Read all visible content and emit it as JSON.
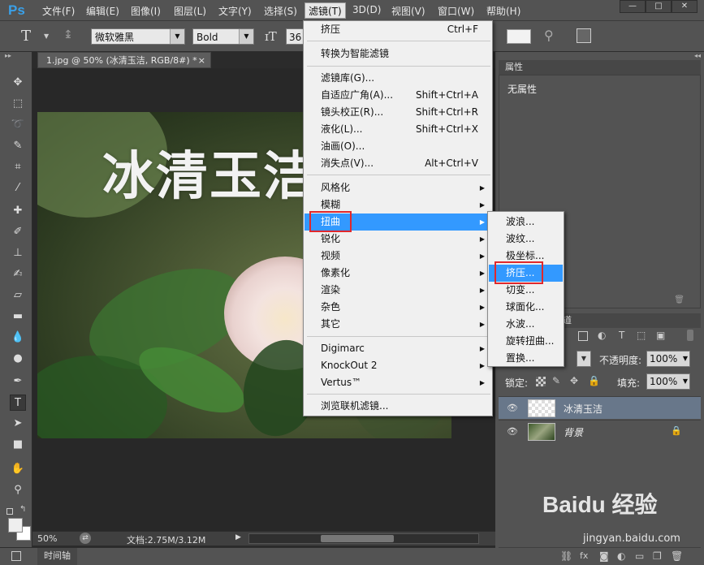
{
  "menubar": {
    "logo": "Ps",
    "items": [
      "文件(F)",
      "编辑(E)",
      "图像(I)",
      "图层(L)",
      "文字(Y)",
      "选择(S)",
      "滤镜(T)",
      "3D(D)",
      "视图(V)",
      "窗口(W)",
      "帮助(H)"
    ],
    "active_index": 6,
    "window_controls": [
      "—",
      "□",
      "✕"
    ]
  },
  "options_bar": {
    "tool_glyph": "T",
    "font_family": "微软雅黑",
    "font_style": "Bold",
    "font_size": "36"
  },
  "document": {
    "tab_label": "1.jpg @ 50% (冰清玉洁, RGB/8#) *",
    "overlay_text": "冰清玉洁",
    "zoom": "50%",
    "doc_size": "文档:2.75M/3.12M"
  },
  "timeline": {
    "label": "时间轴"
  },
  "filter_menu": {
    "groups": [
      [
        {
          "label": "挤压",
          "shortcut": "Ctrl+F"
        }
      ],
      [
        {
          "label": "转换为智能滤镜",
          "shortcut": ""
        }
      ],
      [
        {
          "label": "滤镜库(G)...",
          "shortcut": ""
        },
        {
          "label": "自适应广角(A)...",
          "shortcut": "Shift+Ctrl+A"
        },
        {
          "label": "镜头校正(R)...",
          "shortcut": "Shift+Ctrl+R"
        },
        {
          "label": "液化(L)...",
          "shortcut": "Shift+Ctrl+X"
        },
        {
          "label": "油画(O)...",
          "shortcut": ""
        },
        {
          "label": "消失点(V)...",
          "shortcut": "Alt+Ctrl+V"
        }
      ],
      [
        {
          "label": "风格化",
          "shortcut": "",
          "submenu": true
        },
        {
          "label": "模糊",
          "shortcut": "",
          "submenu": true
        },
        {
          "label": "扭曲",
          "shortcut": "",
          "submenu": true,
          "highlighted": true
        },
        {
          "label": "锐化",
          "shortcut": "",
          "submenu": true
        },
        {
          "label": "视频",
          "shortcut": "",
          "submenu": true
        },
        {
          "label": "像素化",
          "shortcut": "",
          "submenu": true
        },
        {
          "label": "渲染",
          "shortcut": "",
          "submenu": true
        },
        {
          "label": "杂色",
          "shortcut": "",
          "submenu": true
        },
        {
          "label": "其它",
          "shortcut": "",
          "submenu": true
        }
      ],
      [
        {
          "label": "Digimarc",
          "shortcut": "",
          "submenu": true
        },
        {
          "label": "KnockOut 2",
          "shortcut": "",
          "submenu": true
        },
        {
          "label": "Vertus™",
          "shortcut": "",
          "submenu": true
        }
      ],
      [
        {
          "label": "浏览联机滤镜...",
          "shortcut": ""
        }
      ]
    ]
  },
  "distort_submenu": {
    "items": [
      "波浪...",
      "波纹...",
      "极坐标...",
      "挤压...",
      "切变...",
      "球面化...",
      "水波...",
      "旋转扭曲...",
      "置换..."
    ],
    "highlighted_index": 3
  },
  "properties_panel": {
    "title": "属性",
    "empty_text": "无属性"
  },
  "layers_panel": {
    "tab_partial": "通道",
    "opacity_label": "不透明度:",
    "opacity_value": "100%",
    "lock_label": "锁定:",
    "fill_label": "填充:",
    "fill_value": "100%",
    "layers": [
      {
        "name": "冰清玉洁",
        "selected": true
      },
      {
        "name": "背景",
        "selected": false,
        "locked": true
      }
    ]
  },
  "watermark": {
    "brand": "Baidu 经验",
    "url": "jingyan.baidu.com"
  },
  "colors": {
    "accent": "#3399ff",
    "highlight_box": "#e0282c",
    "panel": "#535353",
    "menu_bg": "#f0f0f0"
  }
}
